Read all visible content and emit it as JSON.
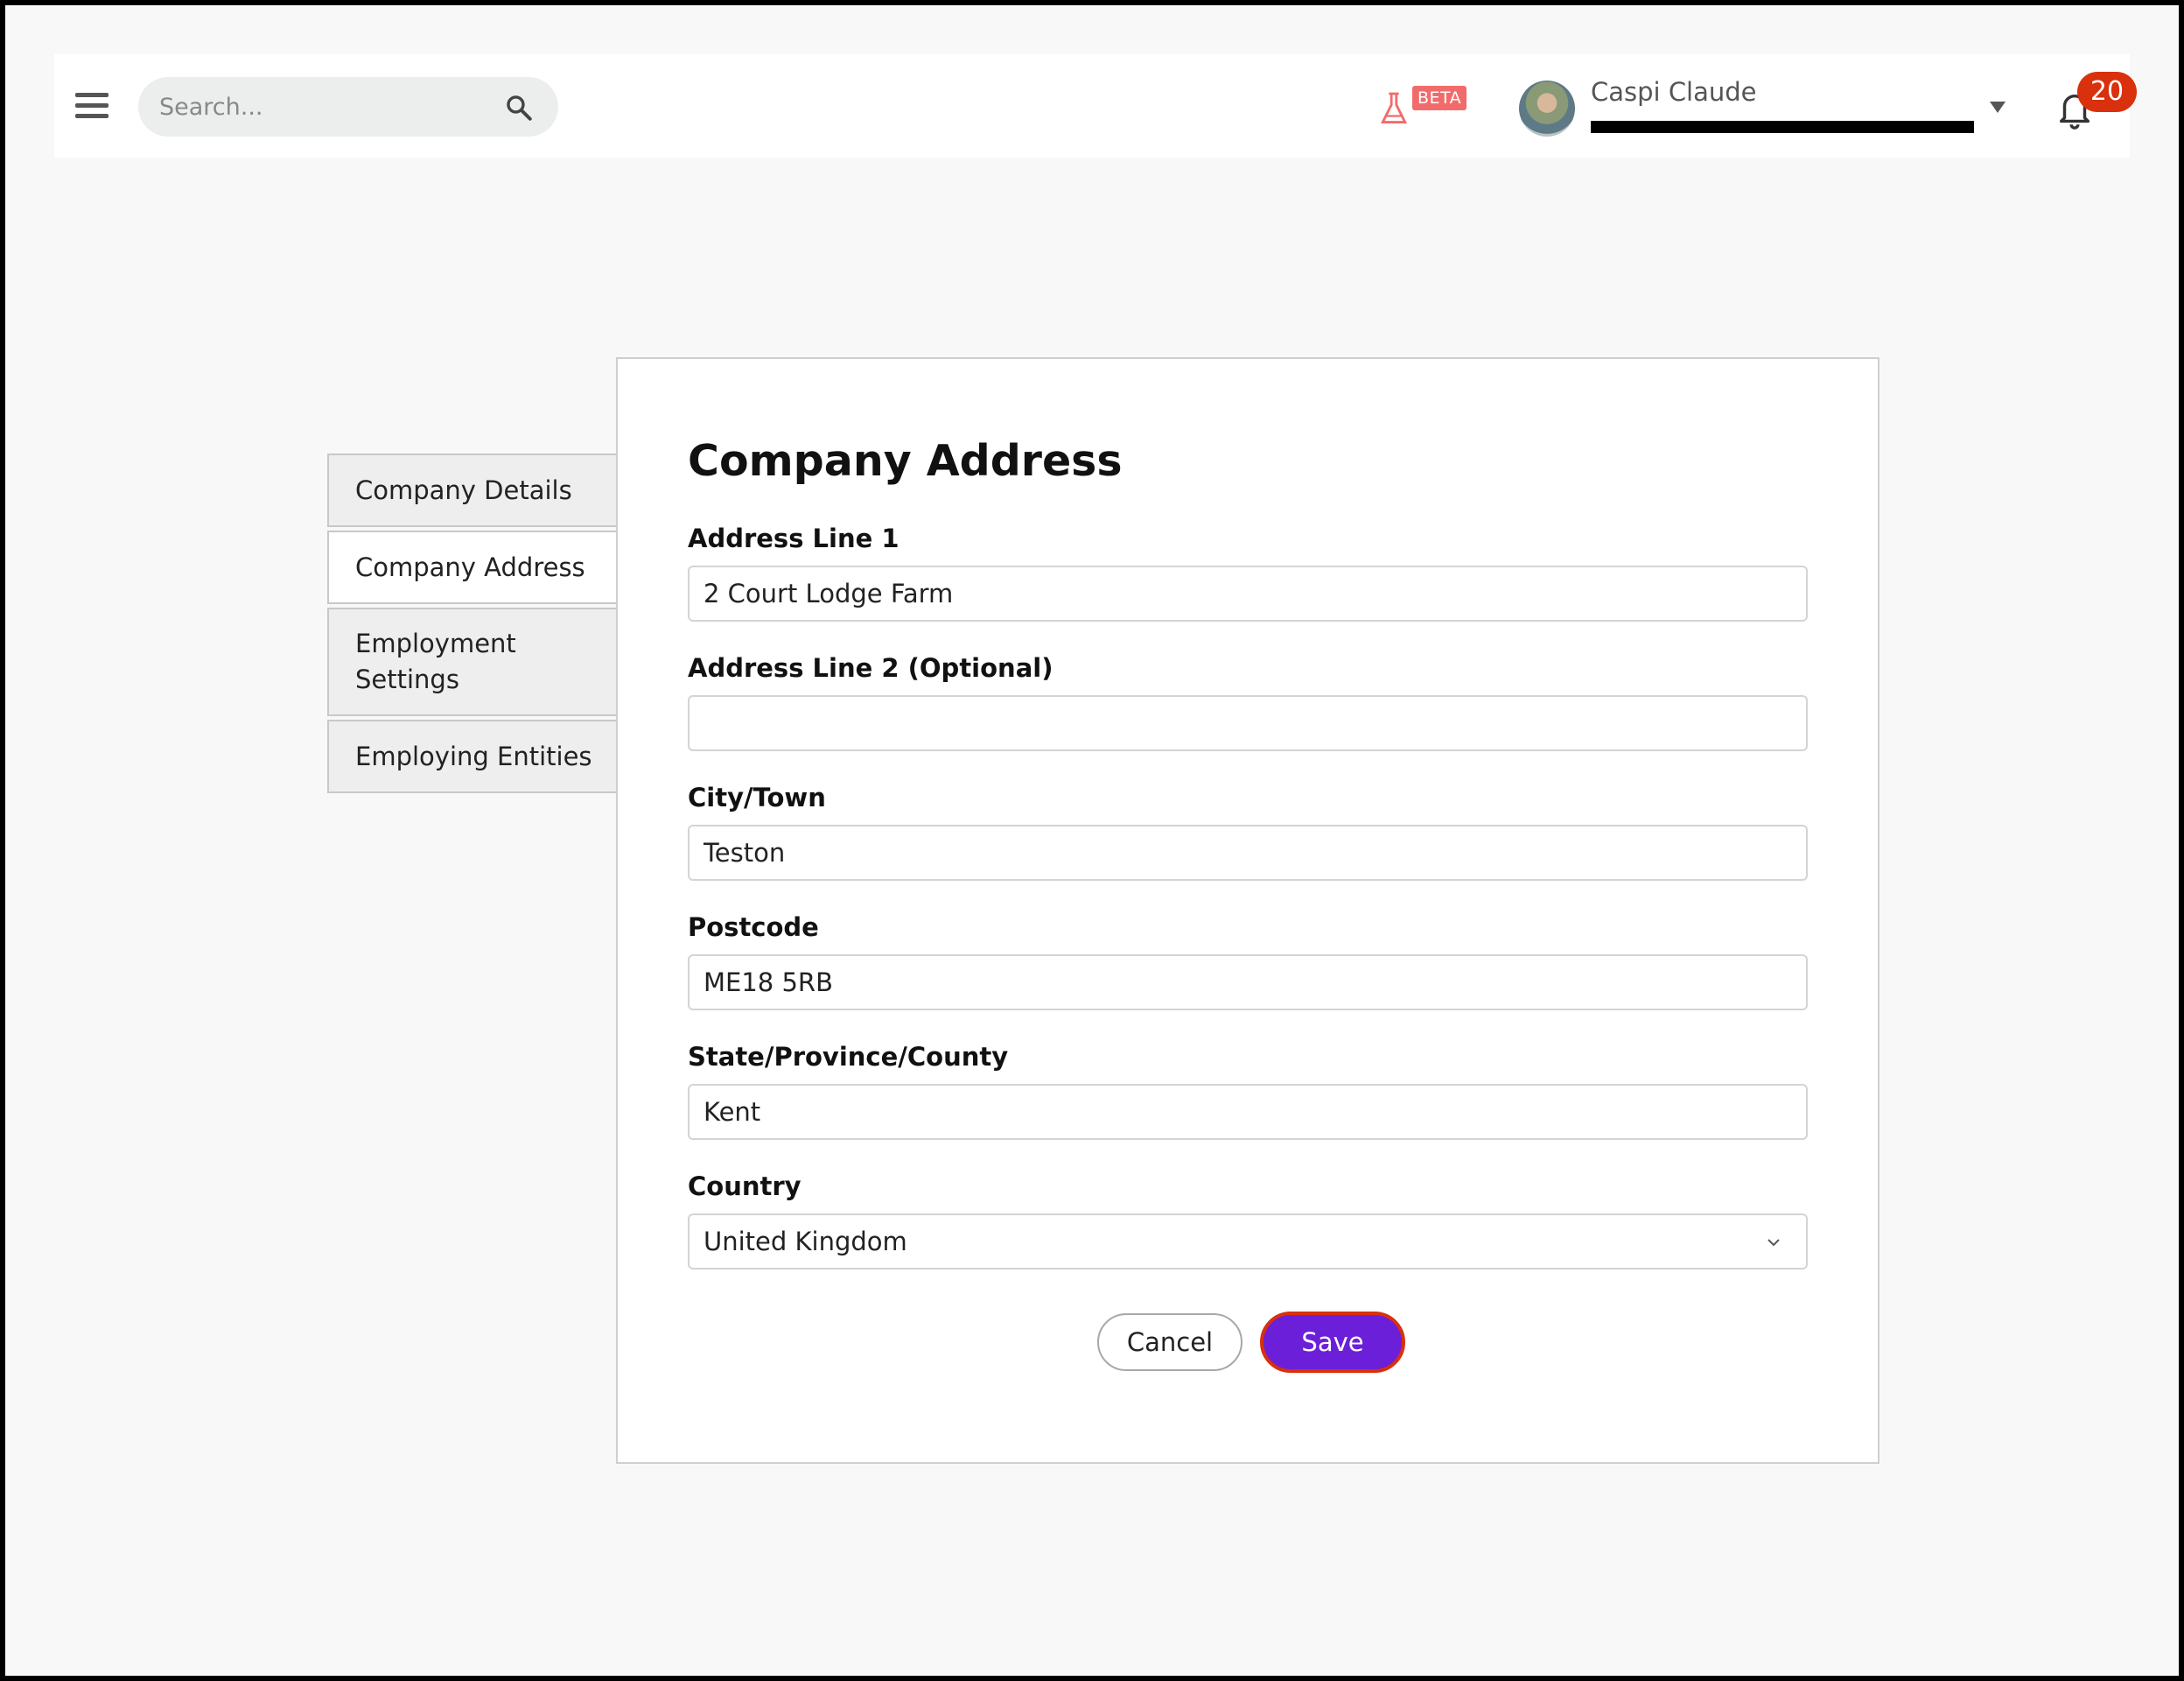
{
  "header": {
    "search_placeholder": "Search...",
    "beta_label": "BETA",
    "user_name": "Caspi Claude",
    "notification_count": "20"
  },
  "sidebar": {
    "tabs": [
      {
        "label": "Company Details"
      },
      {
        "label": "Company Address"
      },
      {
        "label": "Employment Settings"
      },
      {
        "label": "Employing Entities"
      }
    ]
  },
  "form": {
    "title": "Company Address",
    "fields": [
      {
        "label": "Address Line 1",
        "value": "2 Court Lodge Farm"
      },
      {
        "label": "Address Line 2 (Optional)",
        "value": ""
      },
      {
        "label": "City/Town",
        "value": "Teston"
      },
      {
        "label": "Postcode",
        "value": "ME18 5RB"
      },
      {
        "label": "State/Province/County",
        "value": "Kent"
      },
      {
        "label": "Country",
        "value": "United Kingdom"
      }
    ],
    "cancel_label": "Cancel",
    "save_label": "Save"
  },
  "colors": {
    "accent": "#6b1fd8",
    "badge": "#d9300d",
    "beta": "#f26b6b"
  }
}
